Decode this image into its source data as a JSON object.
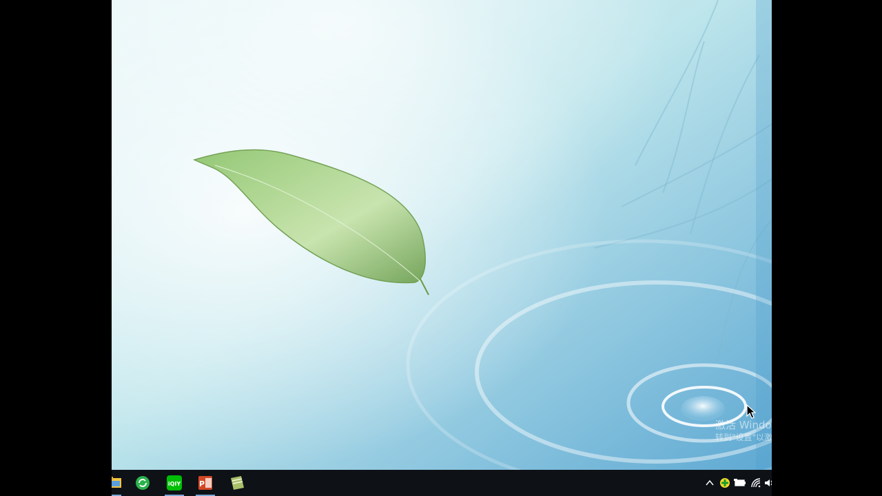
{
  "desktop": {
    "wallpaper": {
      "top_color": "#dff3f6",
      "bottom_color": "#6fb7d8",
      "leaf_color": "#7fb35a",
      "ripple_color": "#ffffff"
    },
    "watermark": {
      "line1": "激活 Windows",
      "line2": "转到\"设置\"以激活 Windows。"
    }
  },
  "taskbar": {
    "background": "#0e1217",
    "pinned": [
      {
        "name": "file-explorer",
        "icon": "folder-icon",
        "active": true
      },
      {
        "name": "app-green",
        "icon": "refresh-green-icon",
        "active": false
      },
      {
        "name": "iqiyi",
        "icon": "iqiyi-icon",
        "label": "iQIY",
        "active": true
      },
      {
        "name": "powerpoint",
        "icon": "powerpoint-icon",
        "label": "P",
        "active": true
      },
      {
        "name": "notes",
        "icon": "notepad-icon",
        "active": false
      }
    ],
    "tray": [
      {
        "name": "show-hidden-icons",
        "icon": "chevron-up-icon"
      },
      {
        "name": "security-app",
        "icon": "green-plus-shield-icon"
      },
      {
        "name": "battery",
        "icon": "battery-icon"
      },
      {
        "name": "network",
        "icon": "wifi-icon"
      },
      {
        "name": "volume",
        "icon": "speaker-icon"
      }
    ]
  }
}
